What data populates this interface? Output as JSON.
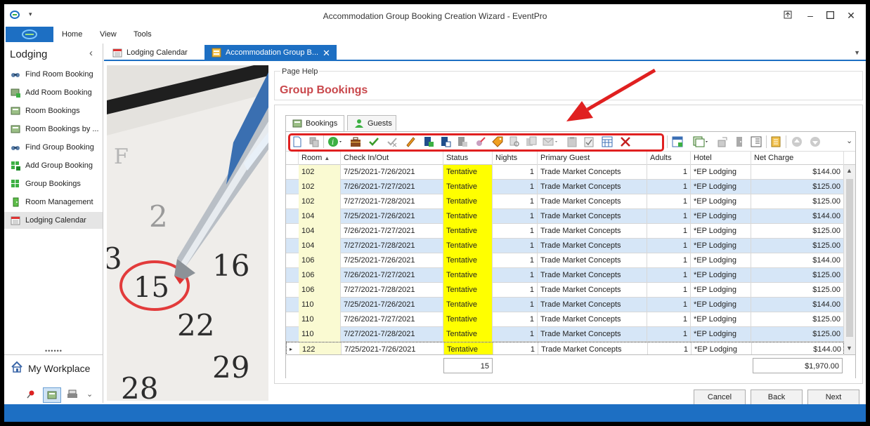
{
  "window": {
    "title": "Accommodation Group Booking Creation Wizard - EventPro"
  },
  "ribbon": {
    "tabs": [
      "Home",
      "View",
      "Tools"
    ]
  },
  "left_panel": {
    "title": "Lodging",
    "items": [
      {
        "label": "Find Room Booking",
        "icon": "binoculars-icon"
      },
      {
        "label": "Add Room Booking",
        "icon": "add-room-icon"
      },
      {
        "label": "Room Bookings",
        "icon": "room-list-icon"
      },
      {
        "label": "Room Bookings by ...",
        "icon": "room-list-icon"
      },
      {
        "label": "Find Group Booking",
        "icon": "binoculars-icon"
      },
      {
        "label": "Add Group Booking",
        "icon": "add-group-icon"
      },
      {
        "label": "Group Bookings",
        "icon": "group-grid-icon"
      },
      {
        "label": "Room Management",
        "icon": "door-icon"
      },
      {
        "label": "Lodging Calendar",
        "icon": "calendar-icon"
      }
    ],
    "workplace_label": "My Workplace"
  },
  "doc_tabs": [
    {
      "label": "Lodging Calendar"
    },
    {
      "label": "Accommodation Group B..."
    }
  ],
  "page_help": {
    "caption": "Page Help",
    "heading": "Group Bookings"
  },
  "content_tabs": [
    {
      "label": "Bookings"
    },
    {
      "label": "Guests"
    }
  ],
  "grid": {
    "columns": [
      "Room",
      "Check In/Out",
      "Status",
      "Nights",
      "Primary Guest",
      "Adults",
      "Hotel",
      "Net Charge"
    ],
    "rows": [
      {
        "room": "102",
        "dates": "7/25/2021-7/26/2021",
        "status": "Tentative",
        "nights": "1",
        "guest": "Trade Market Concepts",
        "adults": "1",
        "hotel": "*EP Lodging",
        "charge": "$144.00"
      },
      {
        "room": "102",
        "dates": "7/26/2021-7/27/2021",
        "status": "Tentative",
        "nights": "1",
        "guest": "Trade Market Concepts",
        "adults": "1",
        "hotel": "*EP Lodging",
        "charge": "$125.00"
      },
      {
        "room": "102",
        "dates": "7/27/2021-7/28/2021",
        "status": "Tentative",
        "nights": "1",
        "guest": "Trade Market Concepts",
        "adults": "1",
        "hotel": "*EP Lodging",
        "charge": "$125.00"
      },
      {
        "room": "104",
        "dates": "7/25/2021-7/26/2021",
        "status": "Tentative",
        "nights": "1",
        "guest": "Trade Market Concepts",
        "adults": "1",
        "hotel": "*EP Lodging",
        "charge": "$144.00"
      },
      {
        "room": "104",
        "dates": "7/26/2021-7/27/2021",
        "status": "Tentative",
        "nights": "1",
        "guest": "Trade Market Concepts",
        "adults": "1",
        "hotel": "*EP Lodging",
        "charge": "$125.00"
      },
      {
        "room": "104",
        "dates": "7/27/2021-7/28/2021",
        "status": "Tentative",
        "nights": "1",
        "guest": "Trade Market Concepts",
        "adults": "1",
        "hotel": "*EP Lodging",
        "charge": "$125.00"
      },
      {
        "room": "106",
        "dates": "7/25/2021-7/26/2021",
        "status": "Tentative",
        "nights": "1",
        "guest": "Trade Market Concepts",
        "adults": "1",
        "hotel": "*EP Lodging",
        "charge": "$144.00"
      },
      {
        "room": "106",
        "dates": "7/26/2021-7/27/2021",
        "status": "Tentative",
        "nights": "1",
        "guest": "Trade Market Concepts",
        "adults": "1",
        "hotel": "*EP Lodging",
        "charge": "$125.00"
      },
      {
        "room": "106",
        "dates": "7/27/2021-7/28/2021",
        "status": "Tentative",
        "nights": "1",
        "guest": "Trade Market Concepts",
        "adults": "1",
        "hotel": "*EP Lodging",
        "charge": "$125.00"
      },
      {
        "room": "110",
        "dates": "7/25/2021-7/26/2021",
        "status": "Tentative",
        "nights": "1",
        "guest": "Trade Market Concepts",
        "adults": "1",
        "hotel": "*EP Lodging",
        "charge": "$144.00"
      },
      {
        "room": "110",
        "dates": "7/26/2021-7/27/2021",
        "status": "Tentative",
        "nights": "1",
        "guest": "Trade Market Concepts",
        "adults": "1",
        "hotel": "*EP Lodging",
        "charge": "$125.00"
      },
      {
        "room": "110",
        "dates": "7/27/2021-7/28/2021",
        "status": "Tentative",
        "nights": "1",
        "guest": "Trade Market Concepts",
        "adults": "1",
        "hotel": "*EP Lodging",
        "charge": "$125.00"
      },
      {
        "room": "122",
        "dates": "7/25/2021-7/26/2021",
        "status": "Tentative",
        "nights": "1",
        "guest": "Trade Market Concepts",
        "adults": "1",
        "hotel": "*EP Lodging",
        "charge": "$144.00"
      }
    ],
    "footer": {
      "nights_total": "15",
      "charge_total": "$1,970.00"
    }
  },
  "buttons": {
    "cancel": "Cancel",
    "back": "Back",
    "next": "Next"
  },
  "colors": {
    "accent": "#1d6fc3",
    "status_tentative": "#ffff00",
    "heading_red": "#c9484c",
    "annotation_red": "#e02020"
  }
}
